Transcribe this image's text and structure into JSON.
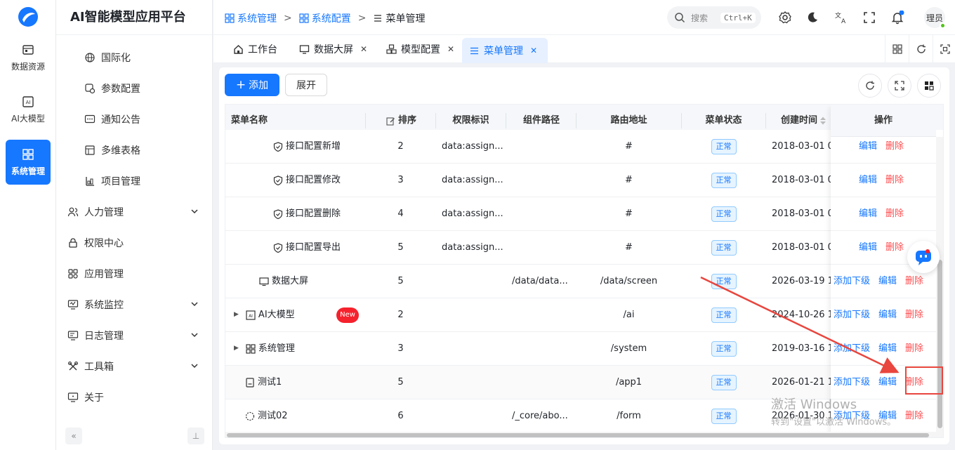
{
  "app": {
    "title": "AI智能模型应用平台"
  },
  "rail": [
    {
      "label": "数据资源",
      "icon": "data-resource-icon"
    },
    {
      "label": "AI大模型",
      "icon": "ai-model-icon"
    },
    {
      "label": "系统管理",
      "icon": "system-icon",
      "active": true
    }
  ],
  "sidebar": {
    "items": [
      {
        "label": "国际化",
        "icon": "globe-icon",
        "sub": true
      },
      {
        "label": "参数配置",
        "icon": "params-icon",
        "sub": true
      },
      {
        "label": "通知公告",
        "icon": "notice-icon",
        "sub": true
      },
      {
        "label": "多维表格",
        "icon": "table-icon",
        "sub": true
      },
      {
        "label": "项目管理",
        "icon": "project-icon",
        "sub": true
      },
      {
        "label": "人力管理",
        "icon": "people-icon",
        "expandable": true
      },
      {
        "label": "权限中心",
        "icon": "lock-icon"
      },
      {
        "label": "应用管理",
        "icon": "apps-icon"
      },
      {
        "label": "系统监控",
        "icon": "monitor-icon",
        "expandable": true
      },
      {
        "label": "日志管理",
        "icon": "log-icon",
        "expandable": true
      },
      {
        "label": "工具箱",
        "icon": "tools-icon",
        "expandable": true
      },
      {
        "label": "关于",
        "icon": "about-icon"
      }
    ],
    "collapse_glyph": "«",
    "pin_glyph": "⊥"
  },
  "breadcrumb": {
    "items": [
      "系统管理",
      "系统配置",
      "菜单管理"
    ],
    "sep": ">"
  },
  "search": {
    "placeholder": "搜索",
    "shortcut": "Ctrl+K"
  },
  "user": {
    "avatar_text": "理员"
  },
  "tabs": [
    {
      "label": "工作台",
      "closable": false
    },
    {
      "label": "数据大屏",
      "closable": true
    },
    {
      "label": "模型配置",
      "closable": true
    },
    {
      "label": "菜单管理",
      "closable": true,
      "active": true
    }
  ],
  "toolbar": {
    "add_label": "添加",
    "expand_label": "展开"
  },
  "table": {
    "headers": {
      "name": "菜单名称",
      "sort": "排序",
      "perm": "权限标识",
      "component": "组件路径",
      "route": "路由地址",
      "status": "菜单状态",
      "created": "创建时间",
      "ops": "操作"
    },
    "rows": [
      {
        "name": "接口配置新增",
        "icon": "shield-icon",
        "level": 3,
        "sort": "2",
        "perm": "data:assign...",
        "component": "",
        "route": "#",
        "status": "正常",
        "created": "2018-03-01 0(",
        "ops": [
          "编辑",
          "删除"
        ]
      },
      {
        "name": "接口配置修改",
        "icon": "shield-icon",
        "level": 3,
        "sort": "3",
        "perm": "data:assign...",
        "component": "",
        "route": "#",
        "status": "正常",
        "created": "2018-03-01 0(",
        "ops": [
          "编辑",
          "删除"
        ]
      },
      {
        "name": "接口配置删除",
        "icon": "shield-icon",
        "level": 3,
        "sort": "4",
        "perm": "data:assign...",
        "component": "",
        "route": "#",
        "status": "正常",
        "created": "2018-03-01 0(",
        "ops": [
          "编辑",
          "删除"
        ]
      },
      {
        "name": "接口配置导出",
        "icon": "shield-icon",
        "level": 3,
        "sort": "5",
        "perm": "data:assign...",
        "component": "",
        "route": "#",
        "status": "正常",
        "created": "2018-03-01 0(",
        "ops": [
          "编辑",
          "删除"
        ]
      },
      {
        "name": "数据大屏",
        "icon": "screen-icon",
        "level": 2,
        "sort": "5",
        "perm": "",
        "component": "/data/data...",
        "route": "/data/screen",
        "status": "正常",
        "created": "2026-03-19 1",
        "ops": [
          "添加下级",
          "编辑",
          "删除"
        ]
      },
      {
        "name": "AI大模型",
        "icon": "ai-model-icon",
        "level": 1,
        "expander": true,
        "badge": "New",
        "sort": "2",
        "perm": "",
        "component": "",
        "route": "/ai",
        "status": "正常",
        "created": "2024-10-26 1",
        "ops": [
          "添加下级",
          "编辑",
          "删除"
        ]
      },
      {
        "name": "系统管理",
        "icon": "system-icon",
        "level": 1,
        "expander": true,
        "sort": "3",
        "perm": "",
        "component": "",
        "route": "/system",
        "status": "正常",
        "created": "2019-03-16 1",
        "ops": [
          "添加下级",
          "编辑",
          "删除"
        ]
      },
      {
        "name": "测试1",
        "icon": "page-icon",
        "level": 1,
        "sort": "5",
        "perm": "",
        "component": "",
        "route": "/app1",
        "status": "正常",
        "created": "2026-01-21 1",
        "ops": [
          "添加下级",
          "编辑",
          "删除"
        ]
      },
      {
        "name": "测试02",
        "icon": "dashed-circle-icon",
        "level": 1,
        "sort": "6",
        "perm": "",
        "component": "/_core/abo...",
        "route": "/form",
        "status": "正常",
        "created": "2026-01-30 1",
        "ops": [
          "添加下级",
          "编辑",
          "删除"
        ]
      }
    ]
  },
  "watermark": {
    "line1": "激活 Windows",
    "line2": "转到\"设置\"以激活 Windows。"
  },
  "colors": {
    "primary": "#1677ff",
    "danger": "#ff4d4f",
    "annotation": "#e8463e"
  }
}
